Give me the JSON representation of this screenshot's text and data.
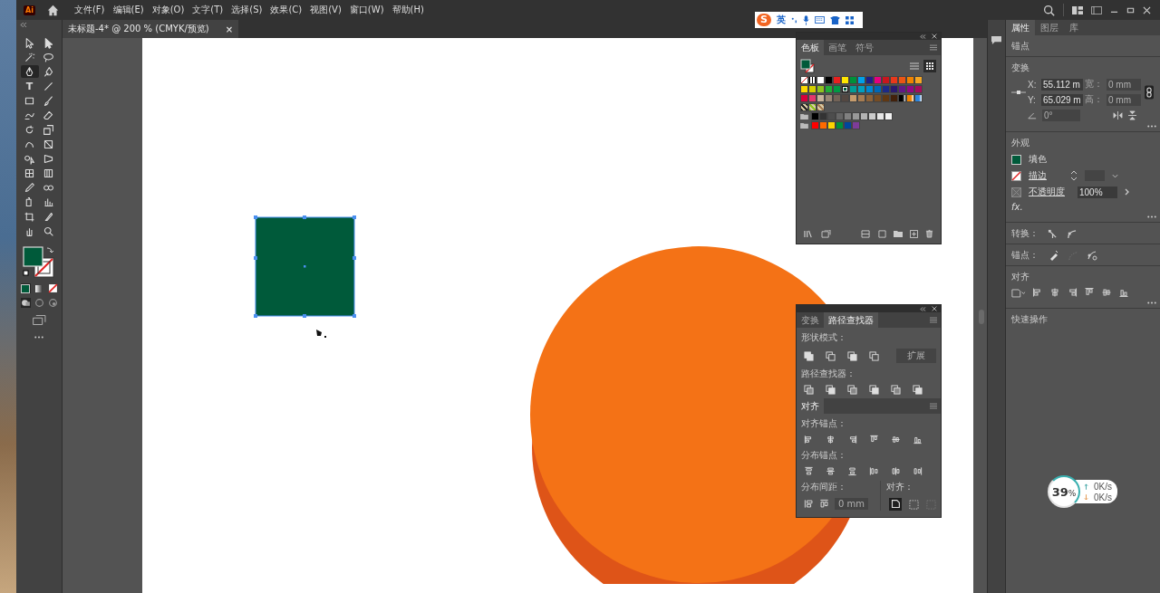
{
  "app_logo": "Ai",
  "menu_bar": {
    "items": [
      "文件(F)",
      "编辑(E)",
      "对象(O)",
      "文字(T)",
      "选择(S)",
      "效果(C)",
      "视图(V)",
      "窗口(W)",
      "帮助(H)"
    ]
  },
  "ime_bar": {
    "logo": "S",
    "label": "英"
  },
  "document_tab": {
    "title": "未标题-4* @ 200 % (CMYK/预览)",
    "close": "×"
  },
  "toolbar": {
    "tools": [
      {
        "selected": false
      },
      {
        "selected": false
      },
      {
        "selected": false
      },
      {
        "selected": false
      },
      {
        "selected": true
      },
      {
        "selected": false
      },
      {
        "selected": false,
        "glyph": "T"
      },
      {
        "selected": false
      },
      {
        "selected": false
      },
      {
        "selected": false
      },
      {
        "selected": false
      },
      {
        "selected": false
      },
      {
        "selected": false
      },
      {
        "selected": false
      },
      {
        "selected": false
      },
      {
        "selected": false
      },
      {
        "selected": false
      },
      {
        "selected": false
      },
      {
        "selected": false
      },
      {
        "selected": false
      },
      {
        "selected": false
      },
      {
        "selected": false
      },
      {
        "selected": false
      },
      {
        "selected": false
      },
      {
        "selected": false
      },
      {
        "selected": false
      },
      {
        "selected": false
      },
      {
        "selected": false
      }
    ]
  },
  "swatches_panel": {
    "tabs": [
      {
        "label": "色板",
        "selected": true
      },
      {
        "label": "画笔",
        "selected": false
      },
      {
        "label": "符号",
        "selected": false
      }
    ],
    "rows": [
      {
        "group": false,
        "swatches": [
          {
            "kind": "none",
            "color": "#ffffff",
            "selected": false
          },
          {
            "kind": "registration",
            "color": "#000000",
            "selected": false
          },
          {
            "kind": "solid",
            "color": "#ffffff",
            "selected": false
          },
          {
            "kind": "solid",
            "color": "#000000",
            "selected": false
          },
          {
            "kind": "solid",
            "color": "#e8201f",
            "selected": false
          },
          {
            "kind": "solid",
            "color": "#ffe600",
            "selected": false
          },
          {
            "kind": "solid",
            "color": "#00913a",
            "selected": false
          },
          {
            "kind": "solid",
            "color": "#00a0e9",
            "selected": false
          },
          {
            "kind": "solid",
            "color": "#1d2088",
            "selected": false
          },
          {
            "kind": "solid",
            "color": "#e4007f",
            "selected": false
          },
          {
            "kind": "solid",
            "color": "#c8161d",
            "selected": false
          },
          {
            "kind": "solid",
            "color": "#e8381b",
            "selected": false
          },
          {
            "kind": "solid",
            "color": "#ea5514",
            "selected": false
          },
          {
            "kind": "solid",
            "color": "#f08300",
            "selected": false
          },
          {
            "kind": "solid",
            "color": "#f5a623",
            "selected": false
          }
        ]
      },
      {
        "group": false,
        "swatches": [
          {
            "kind": "solid",
            "color": "#fcd800",
            "selected": false
          },
          {
            "kind": "solid",
            "color": "#d5d000",
            "selected": false
          },
          {
            "kind": "solid",
            "color": "#8fc31f",
            "selected": false
          },
          {
            "kind": "solid",
            "color": "#22ac38",
            "selected": false
          },
          {
            "kind": "solid",
            "color": "#009944",
            "selected": false
          },
          {
            "kind": "solid",
            "color": "#005a3a",
            "selected": true
          },
          {
            "kind": "solid",
            "color": "#009e96",
            "selected": false
          },
          {
            "kind": "solid",
            "color": "#00a0c1",
            "selected": false
          },
          {
            "kind": "solid",
            "color": "#0086d1",
            "selected": false
          },
          {
            "kind": "solid",
            "color": "#0068b7",
            "selected": false
          },
          {
            "kind": "solid",
            "color": "#1d2a88",
            "selected": false
          },
          {
            "kind": "solid",
            "color": "#2a1a6e",
            "selected": false
          },
          {
            "kind": "solid",
            "color": "#601986",
            "selected": false
          },
          {
            "kind": "solid",
            "color": "#920783",
            "selected": false
          },
          {
            "kind": "solid",
            "color": "#a40b5d",
            "selected": false
          }
        ]
      },
      {
        "group": false,
        "swatches": [
          {
            "kind": "solid",
            "color": "#d7003a",
            "selected": false
          },
          {
            "kind": "solid",
            "color": "#e3366d",
            "selected": false
          },
          {
            "kind": "solid",
            "color": "#c7b299",
            "selected": false
          },
          {
            "kind": "solid",
            "color": "#998675",
            "selected": false
          },
          {
            "kind": "solid",
            "color": "#736357",
            "selected": false
          },
          {
            "kind": "solid",
            "color": "#534741",
            "selected": false
          },
          {
            "kind": "solid",
            "color": "#c69c6d",
            "selected": false
          },
          {
            "kind": "solid",
            "color": "#a67c52",
            "selected": false
          },
          {
            "kind": "solid",
            "color": "#8c6239",
            "selected": false
          },
          {
            "kind": "solid",
            "color": "#754c24",
            "selected": false
          },
          {
            "kind": "solid",
            "color": "#603813",
            "selected": false
          },
          {
            "kind": "solid",
            "color": "#42210b",
            "selected": false
          },
          {
            "kind": "gradient",
            "color": "#000000",
            "selected": false
          },
          {
            "kind": "gradient",
            "color": "#f08300",
            "selected": false
          },
          {
            "kind": "gradient",
            "color": "#2e86de",
            "selected": false
          }
        ]
      },
      {
        "group": false,
        "swatches": [
          {
            "kind": "pattern",
            "color": "#222222",
            "selected": false
          },
          {
            "kind": "pattern",
            "color": "#8fc31f",
            "selected": false
          },
          {
            "kind": "pattern",
            "color": "#a67c52",
            "selected": false
          }
        ]
      },
      {
        "group": true,
        "swatches": [
          {
            "kind": "solid",
            "color": "#000000",
            "selected": false
          },
          {
            "kind": "solid",
            "color": "#333333",
            "selected": false
          },
          {
            "kind": "solid",
            "color": "#4d4d4d",
            "selected": false
          },
          {
            "kind": "solid",
            "color": "#666666",
            "selected": false
          },
          {
            "kind": "solid",
            "color": "#808080",
            "selected": false
          },
          {
            "kind": "solid",
            "color": "#999999",
            "selected": false
          },
          {
            "kind": "solid",
            "color": "#b3b3b3",
            "selected": false
          },
          {
            "kind": "solid",
            "color": "#cccccc",
            "selected": false
          },
          {
            "kind": "solid",
            "color": "#e6e6e6",
            "selected": false
          },
          {
            "kind": "solid",
            "color": "#f2f2f2",
            "selected": false
          }
        ]
      },
      {
        "group": true,
        "swatches": [
          {
            "kind": "solid",
            "color": "#ff0000",
            "selected": false
          },
          {
            "kind": "solid",
            "color": "#ff6a00",
            "selected": false
          },
          {
            "kind": "solid",
            "color": "#ffd400",
            "selected": false
          },
          {
            "kind": "solid",
            "color": "#00913a",
            "selected": false
          },
          {
            "kind": "solid",
            "color": "#00479d",
            "selected": false
          },
          {
            "kind": "solid",
            "color": "#7d3c98",
            "selected": false
          }
        ]
      }
    ]
  },
  "pathfinder_panel": {
    "tabs": [
      {
        "label": "变换",
        "selected": false
      },
      {
        "label": "路径查找器",
        "selected": true
      }
    ],
    "shape_modes_label": "形状模式：",
    "expand_button": {
      "label": "扩展",
      "disabled": true
    },
    "pathfinders_label": "路径查找器："
  },
  "align_panel": {
    "title": "对齐",
    "align_anchors_label": "对齐锚点：",
    "distribute_anchors_label": "分布锚点：",
    "distribute_spacing_label": "分布间距：",
    "spacing_value": "0 mm",
    "spacing_disabled": true,
    "align_to_label": "对齐："
  },
  "properties_panel": {
    "tabs": [
      {
        "label": "属性",
        "selected": true
      },
      {
        "label": "图层",
        "selected": false
      },
      {
        "label": "库",
        "selected": false
      }
    ],
    "selection": "锚点",
    "transform": {
      "title": "变换",
      "x_label": "X:",
      "x_value": "55.112 m",
      "y_label": "Y:",
      "y_value": "65.029 m",
      "width_label": "宽：",
      "width_value": "0 mm",
      "height_label": "高：",
      "height_value": "0 mm",
      "angle_value": "0°",
      "size_disabled": true
    },
    "appearance": {
      "title": "外观",
      "fill_label": "填色",
      "stroke_label": "描边",
      "opacity_label": "不透明度",
      "opacity_value": "100%",
      "fx": "fx."
    },
    "convert_label": "转换：",
    "anchors_label": "锚点：",
    "align_title": "对齐",
    "quick_actions": "快速操作"
  },
  "network_widget": {
    "percent": "39",
    "percent_sign": "%",
    "upload": "0K/s",
    "download": "0K/s"
  }
}
